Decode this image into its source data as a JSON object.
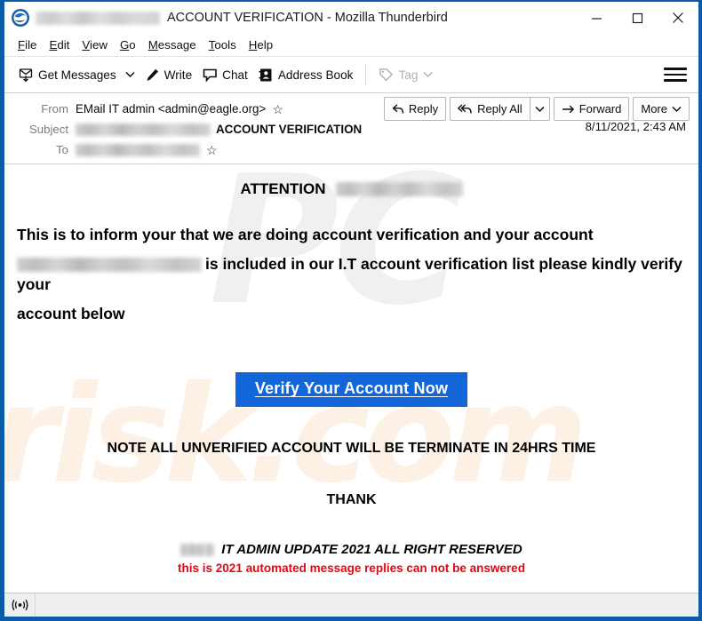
{
  "window": {
    "title_suffix": "ACCOUNT VERIFICATION - Mozilla Thunderbird",
    "logo_icon": "thunderbird-icon",
    "minimize_icon": "minimize-icon",
    "maximize_icon": "maximize-icon",
    "close_icon": "close-icon"
  },
  "menubar": {
    "items": [
      {
        "label": "File",
        "accel": "F"
      },
      {
        "label": "Edit",
        "accel": "E"
      },
      {
        "label": "View",
        "accel": "V"
      },
      {
        "label": "Go",
        "accel": "G"
      },
      {
        "label": "Message",
        "accel": "M"
      },
      {
        "label": "Tools",
        "accel": "T"
      },
      {
        "label": "Help",
        "accel": "H"
      }
    ]
  },
  "toolbar": {
    "get_messages": "Get Messages",
    "write": "Write",
    "chat": "Chat",
    "address_book": "Address Book",
    "tag": "Tag",
    "menu_icon": "hamburger-menu-icon"
  },
  "header": {
    "from_label": "From",
    "from_value": "EMail IT admin <admin@eagle.org>",
    "subject_label": "Subject",
    "subject_value": "ACCOUNT VERIFICATION",
    "to_label": "To",
    "date": "8/11/2021, 2:43 AM"
  },
  "actions": {
    "reply": "Reply",
    "reply_all": "Reply All",
    "forward": "Forward",
    "more": "More"
  },
  "message": {
    "attention_label": "ATTENTION",
    "paragraph_1": "This is  to inform your that  we are doing account verification and your account",
    "paragraph_2": "is included in our I.T account verification list please kindly verify your",
    "paragraph_3": "account below",
    "cta_label": "Verify Your Account Now",
    "note": "NOTE ALL UNVERIFIED ACCOUNT WILL BE TERMINATE IN 24HRS TIME",
    "thank": "THANK",
    "signature": "IT ADMIN UPDATE 2021 ALL RIGHT RESERVED",
    "red_notice": "this is 2021 automated  message replies can not be answered",
    "watermark_top": "PC",
    "watermark_bottom": "risk.com"
  },
  "statusbar": {
    "connection_icon": "broadcast-icon"
  },
  "colors": {
    "window_border": "#0a5ca8",
    "cta_background": "#1266d8",
    "red_notice": "#e30613"
  }
}
